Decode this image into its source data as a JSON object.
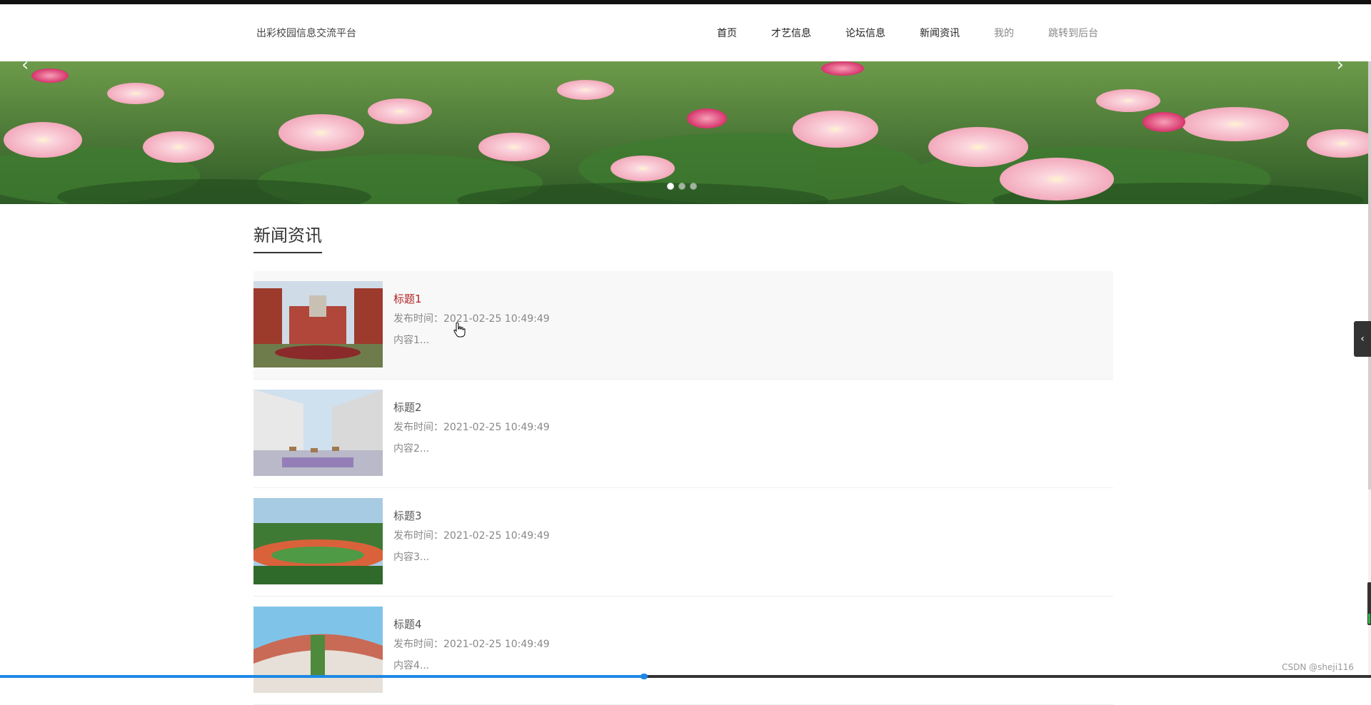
{
  "header": {
    "site_title": "出彩校园信息交流平台",
    "nav": [
      {
        "label": "首页"
      },
      {
        "label": "才艺信息"
      },
      {
        "label": "论坛信息"
      },
      {
        "label": "新闻资讯"
      },
      {
        "label": "我的"
      },
      {
        "label": "跳转到后台"
      }
    ]
  },
  "banner": {
    "prev_arrow": "‹",
    "next_arrow": "›",
    "slide_count": 3,
    "active_slide": 1
  },
  "section": {
    "title": "新闻资讯"
  },
  "news": [
    {
      "title": "标题1",
      "time_label": "发布时间：2021-02-25 10:49:49",
      "excerpt": "内容1..."
    },
    {
      "title": "标题2",
      "time_label": "发布时间：2021-02-25 10:49:49",
      "excerpt": "内容2..."
    },
    {
      "title": "标题3",
      "time_label": "发布时间：2021-02-25 10:49:49",
      "excerpt": "内容3..."
    },
    {
      "title": "标题4",
      "time_label": "发布时间：2021-02-25 10:49:49",
      "excerpt": "内容4..."
    }
  ],
  "side_toggle_icon": "chevron-left-icon",
  "side_toggle_glyph": "‹",
  "progress_fraction": 0.47,
  "watermark": "CSDN @sheji116",
  "colors": {
    "accent_title_hover": "#b22222",
    "progress": "#1e88e5"
  }
}
